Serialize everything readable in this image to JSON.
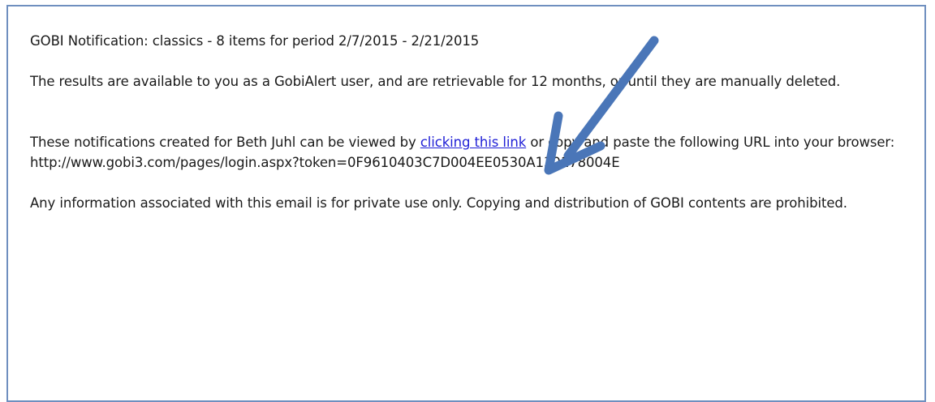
{
  "email": {
    "subject_line": "GOBI Notification: classics - 8 items for period 2/7/2015 - 2/21/2015",
    "availability_text": "The results are available to you as a GobiAlert user, and are retrievable for 12 months, or until they are manually deleted.",
    "view_text_before": "These notifications created for Beth Juhl can be viewed by",
    "link_label": "clicking this link",
    "view_text_after": "or copy and paste the following URL into your browser:",
    "url_text": "http://www.gobi3.com/pages/login.aspx?token=0F9610403C7D004EE0530A130178004E",
    "privacy_text": "Any information associated with this email is for private use only. Copying and distribution of GOBI contents are prohibited."
  },
  "annotation": {
    "arrow_color": "#4a76b8",
    "icon": "arrow-pointer-icon"
  }
}
